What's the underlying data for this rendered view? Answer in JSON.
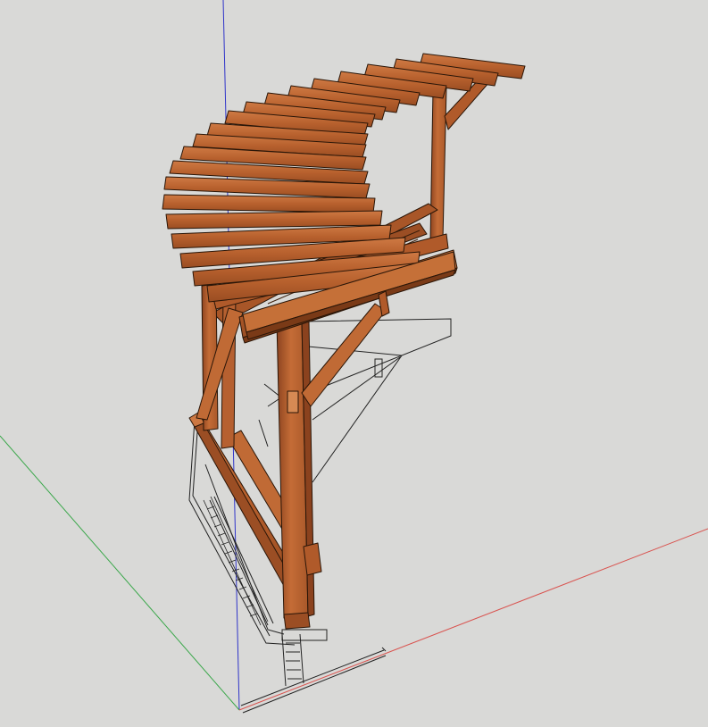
{
  "scene": {
    "background_color": "#d9d9d7",
    "axis_colors": {
      "red": "#d9534f",
      "green": "#3aa74a",
      "blue": "#2f34c9"
    },
    "wood_colors": {
      "base": "#b8612e",
      "light": "#d17b43",
      "dark": "#7a3a17",
      "edge": "#2a1608"
    },
    "objects": [
      "pergola-model",
      "wire-diagram",
      "origin-axes"
    ]
  }
}
